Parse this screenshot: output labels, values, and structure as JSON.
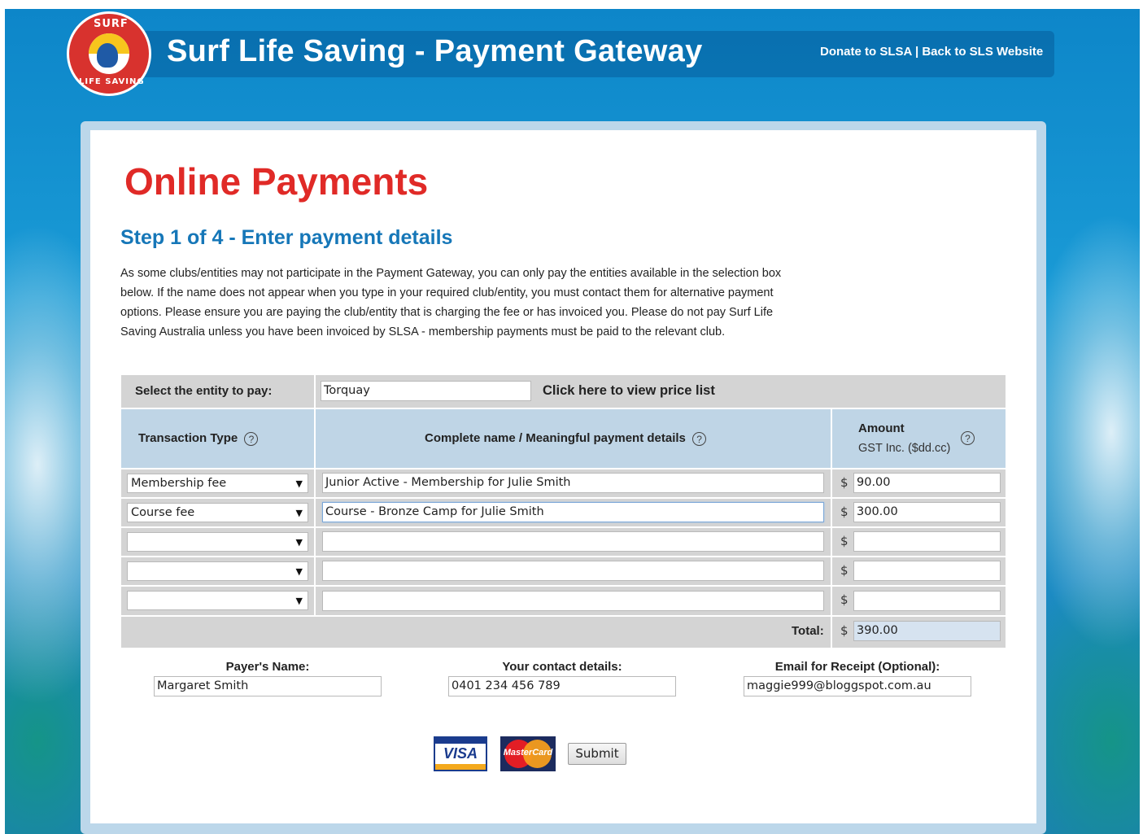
{
  "header": {
    "logo_text_top": "SURF",
    "logo_text_bottom": "LIFE SAVING",
    "title": "Surf Life Saving - Payment Gateway",
    "links": [
      "Donate to SLSA",
      "Back to SLS Website"
    ],
    "separator": "|"
  },
  "page": {
    "title": "Online Payments",
    "step_title": "Step 1 of 4 - Enter payment details",
    "intro": "As some clubs/entities may not participate in the Payment Gateway, you can only pay the entities available in the selection box below. If the name does not appear when you type in your required club/entity, you must contact them for alternative payment options. Please ensure you are paying the club/entity that is charging the fee or has invoiced you. Please do not pay Surf Life Saving Australia unless you have been invoiced by SLSA - membership payments must be paid to the relevant club."
  },
  "entity": {
    "label": "Select the entity to pay:",
    "value": "Torquay",
    "price_list_link": "Click here to view price list"
  },
  "table": {
    "col_transaction_type": "Transaction Type",
    "col_details": "Complete name / Meaningful payment details",
    "col_amount": "Amount",
    "col_amount_sub": "GST Inc. ($dd.cc)",
    "help_symbol": "?",
    "currency": "$",
    "rows": [
      {
        "type": "Membership fee",
        "details": "Junior Active - Membership for Julie Smith",
        "amount": "90.00"
      },
      {
        "type": "Course fee",
        "details": "Course - Bronze Camp for Julie Smith",
        "amount": "300.00"
      },
      {
        "type": "",
        "details": "",
        "amount": ""
      },
      {
        "type": "",
        "details": "",
        "amount": ""
      },
      {
        "type": "",
        "details": "",
        "amount": ""
      }
    ],
    "total_label": "Total:",
    "total_value": "390.00"
  },
  "payer": {
    "name_label": "Payer's Name:",
    "name_value": "Margaret Smith",
    "contact_label": "Your contact details:",
    "contact_value": "0401 234 456 789",
    "email_label": "Email for Receipt (Optional):",
    "email_value": "maggie999@bloggspot.com.au"
  },
  "payment": {
    "visa_label": "VISA",
    "mastercard_label": "MasterCard",
    "submit_label": "Submit"
  },
  "colors": {
    "title_red": "#e02a27",
    "step_blue": "#1677b8",
    "table_grey": "#d4d4d4",
    "header_blue": "#bfd5e6"
  }
}
